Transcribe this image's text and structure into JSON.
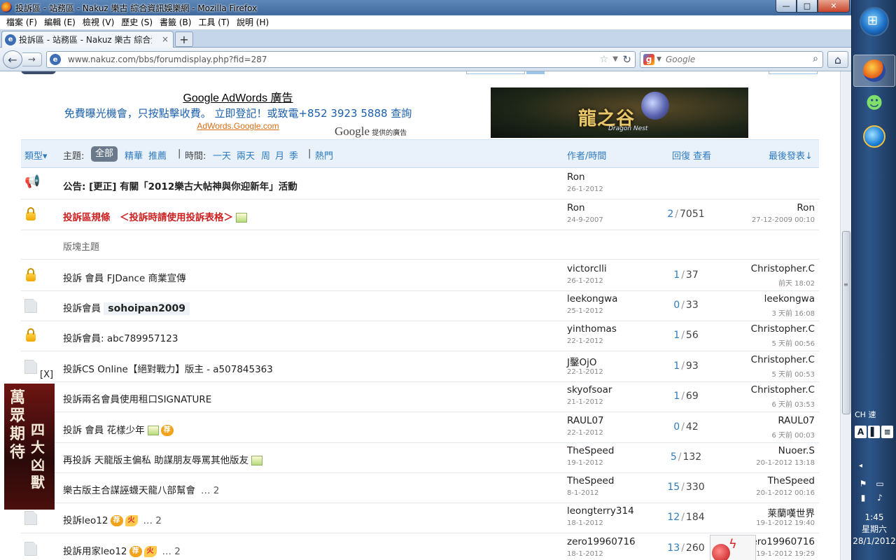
{
  "window": {
    "title": "投訴區 - 站務區 - Nakuz 樂古 綜合資訊娛樂網 - Mozilla Firefox",
    "min_symbol": "—",
    "max_symbol": "□",
    "close_symbol": "✕"
  },
  "menu": [
    "檔案 (F)",
    "編輯 (E)",
    "檢視 (V)",
    "歷史 (S)",
    "書籤 (B)",
    "工具 (T)",
    "說明 (H)"
  ],
  "tab": {
    "label": "投訴區 - 站務區 - Nakuz 樂古 綜合資訊...",
    "close": "×",
    "new_tab": "+"
  },
  "nav": {
    "url": "www.nakuz.com/bbs/forumdisplay.php?fid=287",
    "search_placeholder": "Google",
    "back_symbol": "←",
    "forward_symbol": "→",
    "reload_symbol": "↻",
    "star_symbol": "☆",
    "dropdown_symbol": "▼",
    "search_symbol": "⌕",
    "home_symbol": "⌂"
  },
  "ad": {
    "title": "Google AdWords 廣告",
    "text": "免費曝光機會，只按點擊收費。 立即登記！或致電+852 3923 5888 查詢",
    "url": "AdWords.Google.com",
    "by_brand": "Google",
    "by_suffix": " 提供的廣告"
  },
  "banner": {
    "title": "龍之谷",
    "subtitle": "Dragon Nest"
  },
  "filter": {
    "type_label": "類型▾",
    "topic_label": "主題:",
    "all": "全部",
    "digest": "精華",
    "recommend": "推薦",
    "sep1": "|",
    "time_label": "時間:",
    "one_day": "一天",
    "two_days": "兩天",
    "week": "周",
    "month": "月",
    "season": "季",
    "sep2": "|",
    "hot": "熱門",
    "author_time": "作者/時間",
    "reply_view": "回復 查看",
    "last_post": "最後發表↓"
  },
  "section_label": "版塊主題",
  "announcement": {
    "prefix": "公告: ",
    "title": "[更正] 有關「2012樂古大帖神與你迎新年」活動",
    "author": "Ron",
    "date": "26-1-2012"
  },
  "threads": [
    {
      "icon": "lock",
      "title": "投訴區規條　＜投訴時請使用投訴表格＞",
      "style": "red",
      "img": true,
      "author": "Ron",
      "date": "24-9-2007",
      "replies": "2",
      "views": "7051",
      "last_user": "Ron",
      "last_time": "27-12-2009 00:10"
    },
    {
      "icon": "lock",
      "title": "投訴 會員 FJDance 商業宣傳",
      "author": "victorclli",
      "date": "26-1-2012",
      "replies": "1",
      "views": "37",
      "last_user": "Christopher.C",
      "last_time": "前天 18:02"
    },
    {
      "icon": "doc",
      "title": "投訴會員 ",
      "title_hl": "sohoipan2009",
      "author": "leekongwa",
      "date": "25-1-2012",
      "replies": "0",
      "views": "33",
      "last_user": "leekongwa",
      "last_time": "3 天前 16:08"
    },
    {
      "icon": "lock",
      "title": "投訴會員: abc789957123",
      "author": "yinthomas",
      "date": "22-1-2012",
      "replies": "1",
      "views": "56",
      "last_user": "Christopher.C",
      "last_time": "5 天前 00:56"
    },
    {
      "icon": "doc",
      "title": "投訴CS Online【絕對戰力】版主 - a507845363",
      "author": "J鑿OjO",
      "date": "22-1-2012",
      "replies": "1",
      "views": "93",
      "last_user": "Christopher.C",
      "last_time": "5 天前 00:53"
    },
    {
      "icon": "doc",
      "title": "投訴兩名會員使用租口SIGNATURE",
      "author": "skyofsoar",
      "date": "21-1-2012",
      "replies": "1",
      "views": "69",
      "last_user": "Christopher.C",
      "last_time": "6 天前 03:53"
    },
    {
      "icon": "doc",
      "title": "投訴 會員 花樣少年",
      "img": true,
      "hot": "荐",
      "author": "RAUL07",
      "date": "22-1-2012",
      "replies": "0",
      "views": "42",
      "last_user": "RAUL07",
      "last_time": "6 天前 00:03"
    },
    {
      "icon": "doc",
      "title": "再投訴 天龍版主偏私 助謀朋友辱罵其他版友",
      "img": true,
      "author": "TheSpeed",
      "date": "19-1-2012",
      "replies": "5",
      "views": "132",
      "last_user": "Nuoer.S",
      "last_time": "20-1-2012 13:18"
    },
    {
      "icon": "doc",
      "title": "樂古版主合謀誣蠛天龍八部幫會",
      "more": "… 2",
      "author": "TheSpeed",
      "date": "8-1-2012",
      "replies": "15",
      "views": "330",
      "last_user": "TheSpeed",
      "last_time": "20-1-2012 00:16"
    },
    {
      "icon": "doc",
      "title": "投訴leo12",
      "hot": "荐",
      "fire": "火",
      "more": "… 2",
      "author": "leongterry314",
      "date": "18-1-2012",
      "replies": "12",
      "views": "184",
      "last_user": "莱蘭嘆世界",
      "last_time": "19-1-2012 19:40"
    },
    {
      "icon": "doc",
      "title": "投訴用家leo12",
      "hot": "荐",
      "fire": "火",
      "more": "… 2",
      "author": "zero19960716",
      "date": "18-1-2012",
      "replies": "13",
      "views": "260",
      "last_user": "zero19960716",
      "last_time": "19-1-2012 19:29"
    }
  ],
  "side_ad": {
    "col1": "萬眾期待",
    "col2": "四大凶獸",
    "close": "[X]"
  },
  "taskbar": {
    "start_symbol": "⊞",
    "lang": "CH",
    "lang_ime": "速",
    "ime_a": "A",
    "ime_b": "▌",
    "ime_c": "≡",
    "tray_up": "◂",
    "tray_flag": "⚑",
    "tray_screen": "▭",
    "tray_signal": "▮",
    "tray_volume": "♪",
    "time": "1:45",
    "weekday": "星期六",
    "date": "28/1/2012"
  }
}
